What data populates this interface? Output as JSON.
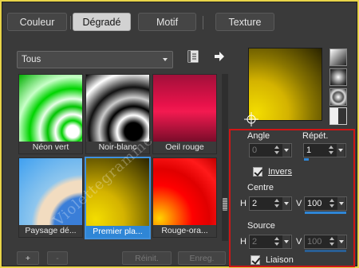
{
  "tabs": [
    {
      "label": "Couleur",
      "active": false
    },
    {
      "label": "Dégradé",
      "active": true
    },
    {
      "label": "Motif",
      "active": false
    },
    {
      "label": "Texture",
      "active": false
    }
  ],
  "category": {
    "selected": "Tous"
  },
  "swatches": [
    {
      "label": "Néon vert",
      "selected": false
    },
    {
      "label": "Noir-blanc",
      "selected": false
    },
    {
      "label": "Oeil rouge",
      "selected": false
    },
    {
      "label": "Paysage dé...",
      "selected": false
    },
    {
      "label": "Premier pla...",
      "selected": true
    },
    {
      "label": "Rouge-ora...",
      "selected": false
    }
  ],
  "bottom_buttons": {
    "add": "+",
    "remove": "-",
    "reset": "Réinit.",
    "save": "Enreg."
  },
  "settings": {
    "angle": {
      "label": "Angle",
      "value": "0",
      "enabled": false
    },
    "repeat": {
      "label": "Répét.",
      "value": "1"
    },
    "invert": {
      "label": "Invers",
      "checked": true
    },
    "center": {
      "label": "Centre",
      "h_label": "H",
      "h_value": "2",
      "v_label": "V",
      "v_value": "100"
    },
    "source": {
      "label": "Source",
      "h_label": "H",
      "h_value": "2",
      "v_label": "V",
      "v_value": "100",
      "enabled": false
    },
    "link": {
      "label": "Liaison",
      "checked": true
    }
  },
  "watermark": "Violettegramme",
  "colors": {
    "accent": "#2f86d6",
    "highlight_box": "#d01515",
    "outer_frame": "#e8d44a"
  }
}
